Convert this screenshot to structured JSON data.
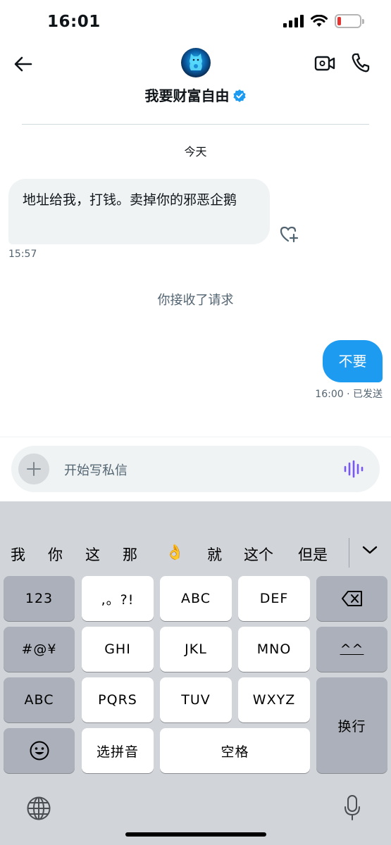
{
  "status_bar": {
    "time": "16:01"
  },
  "header": {
    "contact_name": "我要财富自由"
  },
  "conversation": {
    "date_label": "今天",
    "incoming": {
      "text": "地址给我，打钱。卖掉你的邪恶企鹅",
      "time": "15:57"
    },
    "system_message": "你接收了请求",
    "outgoing": {
      "text": "不要",
      "meta": "16:00 · 已发送"
    }
  },
  "composer": {
    "placeholder": "开始写私信"
  },
  "keyboard": {
    "candidates": [
      "我",
      "你",
      "这",
      "那",
      "👌",
      "就",
      "这个",
      "但是"
    ],
    "rows": {
      "r1": [
        "123",
        ",。?!",
        "ABC",
        "DEF"
      ],
      "r2": [
        "#@¥",
        "GHI",
        "JKL",
        "MNO",
        "^^"
      ],
      "r3": [
        "ABC",
        "PQRS",
        "TUV",
        "WXYZ"
      ],
      "r4": [
        "选拼音",
        "空格"
      ],
      "return_label": "换行"
    }
  },
  "colors": {
    "accent": "#1d9bf0",
    "incoming_bubble": "#eff3f4",
    "keyboard_bg": "#d1d4d9",
    "voice_icon": "#7856ff"
  },
  "icons": [
    "back-arrow-icon",
    "verified-badge-icon",
    "video-call-icon",
    "phone-icon",
    "add-reaction-icon",
    "plus-icon",
    "voice-wave-icon",
    "backspace-icon",
    "emoji-icon",
    "globe-icon",
    "microphone-icon",
    "chevron-down-icon"
  ]
}
